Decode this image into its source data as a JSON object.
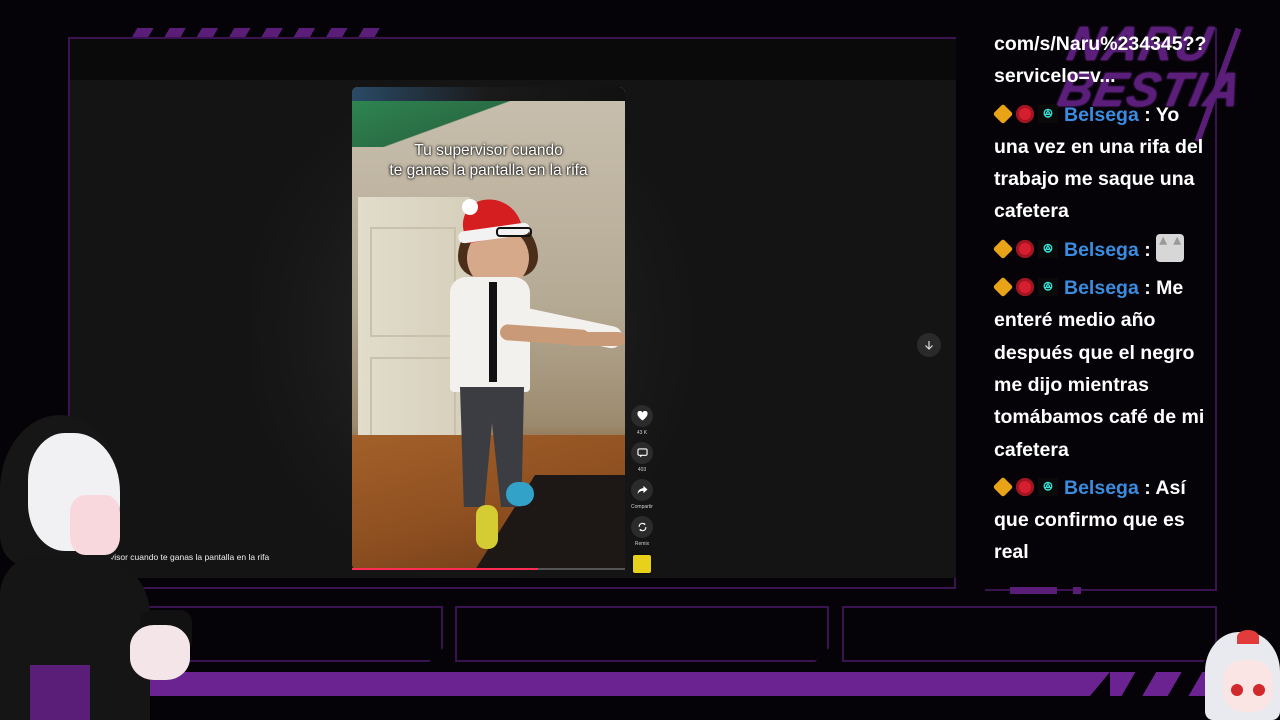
{
  "video": {
    "caption": "Tu supervisor cuando\nte ganas la pantalla en la rifa",
    "description": "visor cuando te ganas la pantalla en la rifa",
    "progress": 0.68,
    "actions": [
      {
        "icon": "heart-icon",
        "label": "43 K"
      },
      {
        "icon": "comment-icon",
        "label": "403"
      },
      {
        "icon": "share-icon",
        "label": "Compartir"
      },
      {
        "icon": "remix-icon",
        "label": "Remix"
      }
    ]
  },
  "chat": {
    "partial_line_1": "com/s/Naru%234345??",
    "partial_line_2": "servicelo=v...",
    "messages": [
      {
        "user": "Belsega",
        "text": "Yo una vez en una rifa del trabajo me saque una cafetera"
      },
      {
        "user": "Belsega",
        "text": "",
        "emote": "cat-emote"
      },
      {
        "user": "Belsega",
        "text": "Me enteré medio año después que el negro me dijo mientras tomábamos café de mi cafetera"
      },
      {
        "user": "Belsega",
        "text": "Así que confirmo que es real"
      }
    ],
    "separator": " : "
  },
  "logo": {
    "line1": "NARU",
    "line2": "BESTIA"
  },
  "colors": {
    "accent": "#6a2390",
    "username": "#3a8ce0",
    "tiktok_red": "#fe2c55"
  }
}
